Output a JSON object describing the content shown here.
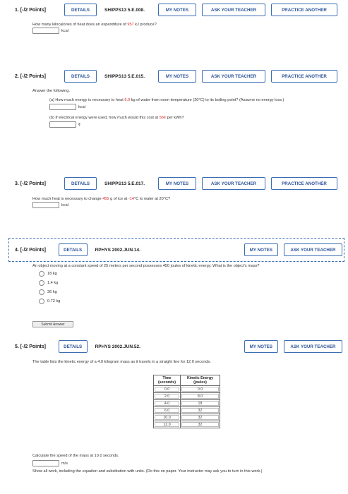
{
  "buttons": {
    "details": "DETAILS",
    "my_notes": "MY NOTES",
    "ask": "ASK YOUR TEACHER",
    "practice": "PRACTICE ANOTHER",
    "submit": "Submit Answer"
  },
  "q1": {
    "num": "1. [-/2 Points]",
    "code": "SHIPPS13 5.E.008.",
    "text_a": "How many kilocalories of heat does an expenditure of ",
    "text_red": "957",
    "text_b": " kJ produce?",
    "unit": "kcal"
  },
  "q2": {
    "num": "2. [-/2 Points]",
    "code": "SHIPPS13 5.E.015.",
    "intro": "Answer the following.",
    "a_text_1": "(a) How much energy is necessary to heat ",
    "a_red": "6.0",
    "a_text_2": " kg of water from room temperature (20°C) to its boiling point? (Assume no energy loss.)",
    "a_unit": "kcal",
    "b_text_1": "(b) If electrical energy were used, how much would this cost at ",
    "b_red": "56¢",
    "b_text_2": " per kWh?",
    "b_unit": "¢"
  },
  "q3": {
    "num": "3. [-/2 Points]",
    "code": "SHIPPS13 5.E.017.",
    "text_1": "How much heat is necessary to change ",
    "red_1": "455",
    "text_2": " g of ice at ",
    "red_2": "-14",
    "text_3": "°C to water at 20°C?",
    "unit": "kcal"
  },
  "q4": {
    "num": "4. [-/2 Points]",
    "code": "RPHYS 2002.JUN.14.",
    "text": "An object moving at a constant speed of 25 meters per second possesses 450 joules of kinetic energy. What is the object's mass?",
    "options": [
      "18 kg",
      "1.4 kg",
      "36 kg",
      "0.72 kg"
    ]
  },
  "q5": {
    "num": "5. [-/2 Points]",
    "code": "RPHYS 2002.JUN.52.",
    "text": "The table lists the kinetic energy of a 4.0 kilogram mass as it travels in a straight line for 12.0 seconds.",
    "table": {
      "headers": [
        "Time (seconds)",
        "Kinetic Energy (joules)"
      ],
      "rows": [
        [
          "0.0",
          "0.0"
        ],
        [
          "2.0",
          "8.0"
        ],
        [
          "4.0",
          "18"
        ],
        [
          "6.0",
          "32"
        ],
        [
          "10.0",
          "32"
        ],
        [
          "12.0",
          "32"
        ]
      ]
    },
    "question": "Calculate the speed of the mass at 10.0 seconds.",
    "unit": "m/s",
    "note": "Show all work, including the equation and substitution with units. (Do this on paper. Your instructor may ask you to turn in this work.)"
  }
}
